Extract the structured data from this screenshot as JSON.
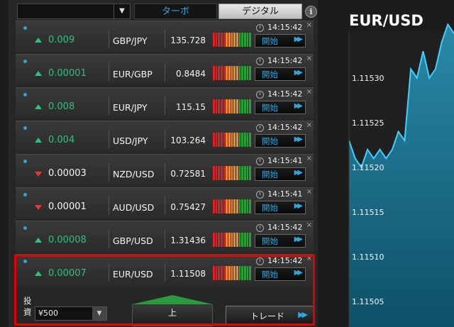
{
  "topbar": {
    "dropdown_value": "",
    "dropdown_arrow": "▼",
    "tab_turbo": "ターボ",
    "tab_digital": "デジタル",
    "info": "i"
  },
  "rows": [
    {
      "direction": "up",
      "change": "0.009",
      "pair": "GBP/JPY",
      "price": "135.728",
      "time": "14:15:42",
      "start": "開始",
      "close": "×"
    },
    {
      "direction": "up",
      "change": "0.00001",
      "pair": "EUR/GBP",
      "price": "0.8484",
      "time": "14:15:42",
      "start": "開始",
      "close": "×"
    },
    {
      "direction": "up",
      "change": "0.008",
      "pair": "EUR/JPY",
      "price": "115.15",
      "time": "14:15:42",
      "start": "開始",
      "close": "×"
    },
    {
      "direction": "up",
      "change": "0.004",
      "pair": "USD/JPY",
      "price": "103.264",
      "time": "14:15:42",
      "start": "開始",
      "close": "×"
    },
    {
      "direction": "down",
      "change": "0.00003",
      "pair": "NZD/USD",
      "price": "0.72581",
      "time": "14:15:41",
      "start": "開始",
      "close": "×"
    },
    {
      "direction": "down",
      "change": "0.00001",
      "pair": "AUD/USD",
      "price": "0.75427",
      "time": "14:15:41",
      "start": "開始",
      "close": "×"
    },
    {
      "direction": "up",
      "change": "0.00008",
      "pair": "GBP/USD",
      "price": "1.31436",
      "time": "14:15:42",
      "start": "開始",
      "close": "×"
    },
    {
      "direction": "up",
      "change": "0.00007",
      "pair": "EUR/USD",
      "price": "1.11508",
      "time": "14:15:42",
      "start": "開始",
      "close": "×"
    }
  ],
  "meter_colors": [
    "r",
    "r",
    "r",
    "r",
    "r",
    "o",
    "o",
    "o",
    "o",
    "o",
    "g",
    "g",
    "g",
    "g",
    "g"
  ],
  "trade": {
    "investment_label": "投資",
    "investment_value": "¥500",
    "dropdown_arrow": "▼",
    "up_label": "上",
    "trade_label": "トレード",
    "ff": "▶▶"
  },
  "chart": {
    "title": "EUR/USD",
    "yticks": [
      "1.11530",
      "1.11525",
      "1.11520",
      "1.11515",
      "1.11510",
      "1.11505"
    ],
    "ytick_values": [
      1.1153,
      1.11525,
      1.1152,
      1.11515,
      1.1151,
      1.11505
    ],
    "series": [
      1.11523,
      1.11521,
      1.1152,
      1.11522,
      1.11521,
      1.11522,
      1.11521,
      1.11522,
      1.11524,
      1.11523,
      1.11531,
      1.1153,
      1.11533,
      1.1153,
      1.11531,
      1.11534,
      1.11536,
      1.11535
    ]
  },
  "colors": {
    "accent": "#2ea7e0",
    "up": "#2ec27e",
    "down": "#e53935",
    "highlight": "#e00000",
    "area_top": "#2a8aa8",
    "area_bottom": "#0e5068"
  }
}
